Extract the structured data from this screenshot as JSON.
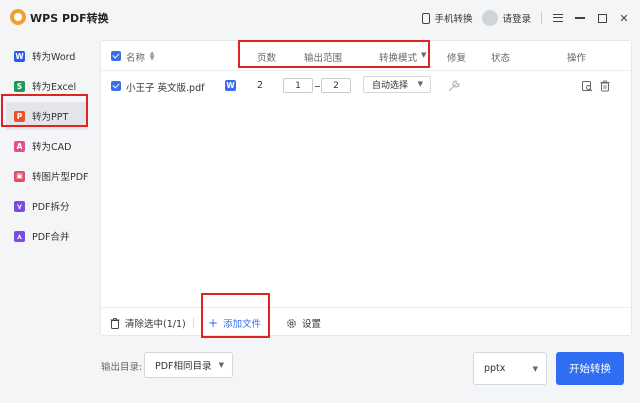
{
  "app": {
    "title": "WPS PDF转换"
  },
  "titlebar": {
    "phone_convert": "手机转换",
    "login": "请登录"
  },
  "sidebar": {
    "items": [
      {
        "label": "转为Word",
        "icon": "W",
        "color": "#2b5ce6"
      },
      {
        "label": "转为Excel",
        "icon": "S",
        "color": "#1c9a56"
      },
      {
        "label": "转为PPT",
        "icon": "P",
        "color": "#e8532a",
        "active": true
      },
      {
        "label": "转为CAD",
        "icon": "A",
        "color": "#e24f8f"
      },
      {
        "label": "转图片型PDF",
        "icon": "▣",
        "color": "#e24f6a"
      },
      {
        "label": "PDF拆分",
        "icon": "⋎",
        "color": "#7a4de2"
      },
      {
        "label": "PDF合并",
        "icon": "⋏",
        "color": "#7a4de2"
      }
    ]
  },
  "table": {
    "headers": {
      "name": "名称",
      "pages": "页数",
      "range": "输出范围",
      "mode": "转换模式",
      "repair": "修复",
      "status": "状态",
      "actions": "操作"
    },
    "rows": [
      {
        "name": "小王子 英文版.pdf",
        "type_badge": "W",
        "pages": "2",
        "range_from": "1",
        "range_to": "2",
        "mode": "自动选择"
      }
    ]
  },
  "footer": {
    "clear": "清除选中(1/1)",
    "add": "添加文件",
    "settings": "设置"
  },
  "bottom": {
    "output_label": "输出目录:",
    "output_dir": "PDF相同目录",
    "format": "pptx",
    "start": "开始转换"
  },
  "colors": {
    "primary": "#2f6ef3",
    "annotation": "#e02424"
  }
}
